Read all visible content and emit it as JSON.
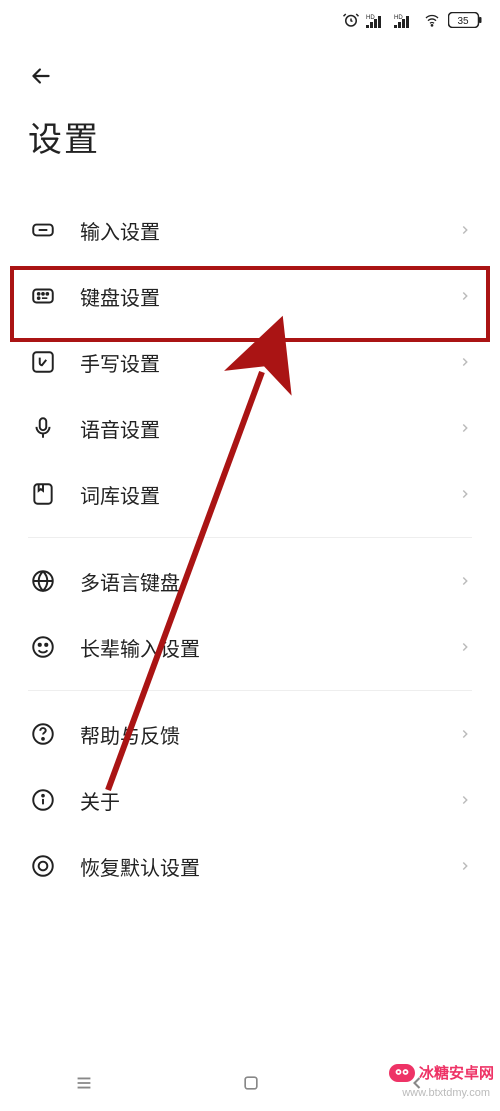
{
  "status": {
    "battery": "35"
  },
  "header": {
    "title": "设置"
  },
  "items": {
    "input": "输入设置",
    "keyboard": "键盘设置",
    "handwrite": "手写设置",
    "voice": "语音设置",
    "dict": "词库设置",
    "multilang": "多语言键盘",
    "elder": "长辈输入设置",
    "help": "帮助与反馈",
    "about": "关于",
    "reset": "恢复默认设置"
  },
  "watermark": {
    "brand": "冰糖安卓网",
    "url": "www.btxtdmy.com"
  }
}
